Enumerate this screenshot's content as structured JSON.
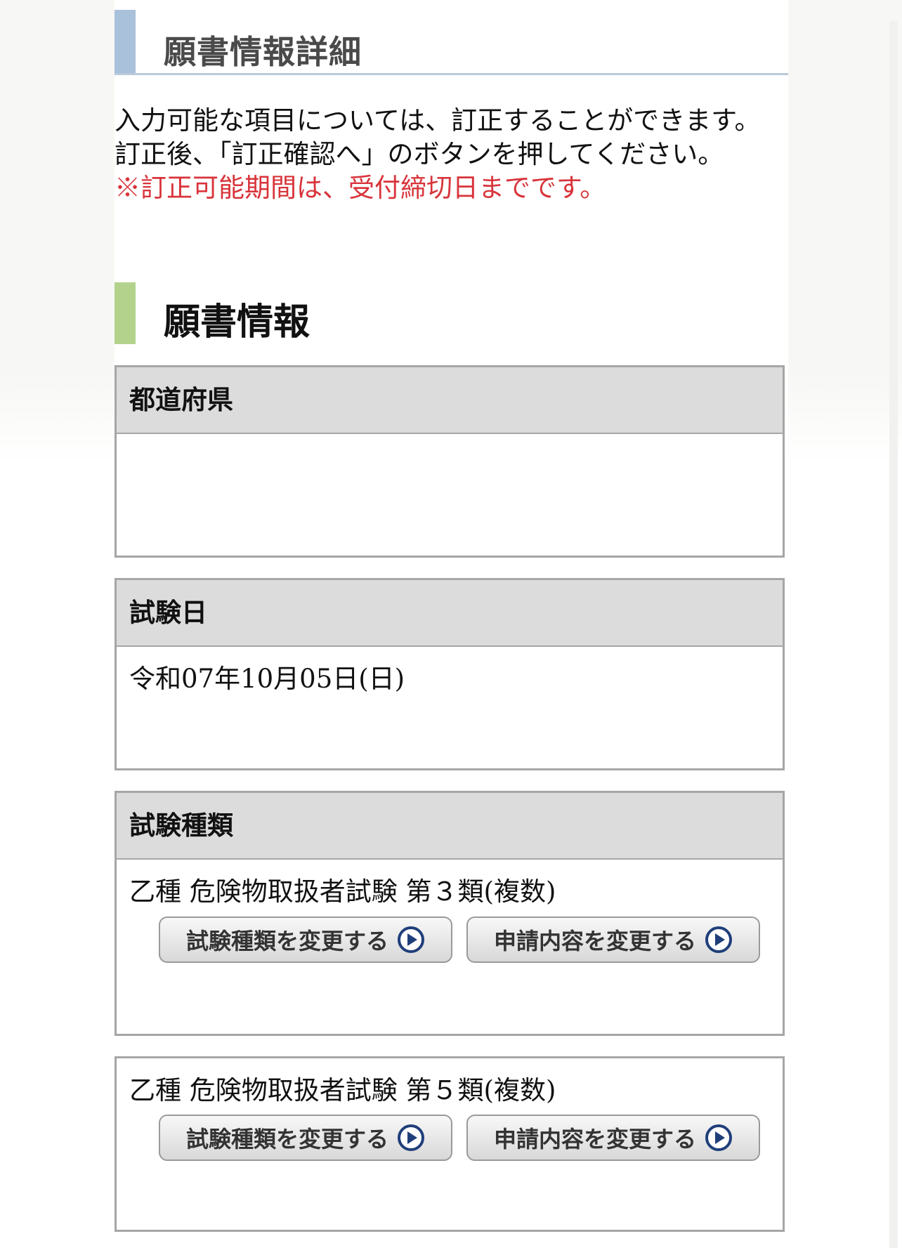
{
  "header": {
    "title": "願書情報詳細"
  },
  "intro": {
    "line1": "入力可能な項目については、訂正することができます。",
    "line2": "訂正後、「訂正確認へ」のボタンを押してください。",
    "warning": "※訂正可能期間は、受付締切日までです。"
  },
  "section": {
    "title": "願書情報"
  },
  "fields": {
    "prefecture": {
      "label": "都道府県",
      "value": ""
    },
    "exam_date": {
      "label": "試験日",
      "value": "令和07年10月05日(日)"
    },
    "exam_type": {
      "label": "試験種類",
      "items": [
        {
          "value": "乙種 危険物取扱者試験 第３類(複数)",
          "change_type_label": "試験種類を変更する",
          "change_content_label": "申請内容を変更する"
        },
        {
          "value": "乙種 危険物取扱者試験 第５類(複数)",
          "change_type_label": "試験種類を変更する",
          "change_content_label": "申請内容を変更する"
        }
      ]
    }
  },
  "icons": {
    "button_icon": "play-circle-icon"
  },
  "colors": {
    "header_accent": "#a9c1da",
    "section_accent": "#b3d38d",
    "warning_text": "#d8343b",
    "label_bg": "#dcdcdc"
  }
}
